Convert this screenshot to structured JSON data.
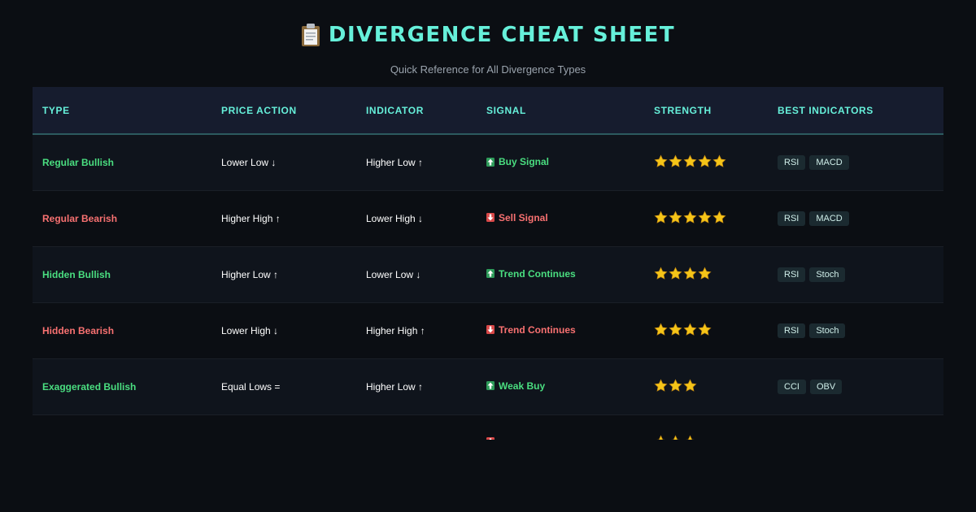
{
  "header": {
    "title": "DIVERGENCE CHEAT SHEET",
    "icon": "clipboard-icon",
    "subtitle": "Quick Reference for All Divergence Types"
  },
  "colors": {
    "accent": "#66f0da",
    "bullish": "#4ade80",
    "bearish": "#f87171",
    "background": "#0b0e13",
    "header_row": "#161c2e"
  },
  "table": {
    "columns": [
      "Type",
      "Price Action",
      "Indicator",
      "Signal",
      "Strength",
      "Best Indicators"
    ],
    "rows": [
      {
        "type": "Regular Bullish",
        "direction": "bull",
        "price": "Lower Low ↓",
        "indicator": "Higher Low ↑",
        "signal": "Buy Signal",
        "signal_icon": "up-arrow-icon",
        "stars": 5,
        "tags": [
          "RSI",
          "MACD"
        ]
      },
      {
        "type": "Regular Bearish",
        "direction": "bear",
        "price": "Higher High ↑",
        "indicator": "Lower High ↓",
        "signal": "Sell Signal",
        "signal_icon": "down-arrow-icon",
        "stars": 5,
        "tags": [
          "RSI",
          "MACD"
        ]
      },
      {
        "type": "Hidden Bullish",
        "direction": "bull",
        "price": "Higher Low ↑",
        "indicator": "Lower Low ↓",
        "signal": "Trend Continues",
        "signal_icon": "up-arrow-icon",
        "stars": 4,
        "tags": [
          "RSI",
          "Stoch"
        ]
      },
      {
        "type": "Hidden Bearish",
        "direction": "bear",
        "price": "Lower High ↓",
        "indicator": "Higher High ↑",
        "signal": "Trend Continues",
        "signal_icon": "down-arrow-icon",
        "stars": 4,
        "tags": [
          "RSI",
          "Stoch"
        ]
      },
      {
        "type": "Exaggerated Bullish",
        "direction": "bull",
        "price": "Equal Lows =",
        "indicator": "Higher Low ↑",
        "signal": "Weak Buy",
        "signal_icon": "up-arrow-icon",
        "stars": 3,
        "tags": [
          "CCI",
          "OBV"
        ]
      },
      {
        "type": "",
        "direction": "bear",
        "price": "",
        "indicator": "",
        "signal": "",
        "signal_icon": "down-arrow-icon",
        "stars": 3,
        "tags": [
          "",
          ""
        ]
      }
    ]
  }
}
